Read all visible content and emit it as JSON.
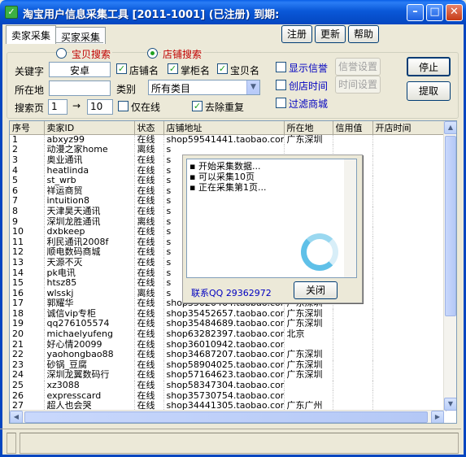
{
  "window": {
    "title": "淘宝用户信息采集工具 [2011-1001] (已注册) 到期:"
  },
  "tabs": [
    "卖家采集",
    "买家采集"
  ],
  "toolbar": {
    "register": "注册",
    "update": "更新",
    "help": "帮助"
  },
  "search": {
    "mode_item": "宝贝搜索",
    "mode_shop": "店铺搜索",
    "selected_mode": "店铺搜索",
    "keyword_label": "关键字",
    "keyword_value": "安卓",
    "location_label": "所在地",
    "location_value": "",
    "category_label": "类别",
    "category_value": "所有类目",
    "pages_label": "搜索页",
    "page_from": "1",
    "page_arrow": "→",
    "page_to": "10",
    "opt_shop_name": "店铺名",
    "opt_owner_name": "掌柜名",
    "opt_item_name": "宝贝名",
    "opt_online_only": "仅在线",
    "opt_dedupe": "去除重复",
    "opt_show_credit": "显示信誉",
    "opt_create_time": "创店时间",
    "opt_filter_mall": "过滤商城",
    "btn_credit_settings": "信誉设置",
    "btn_time_settings": "时间设置",
    "btn_stop": "停止",
    "btn_extract": "提取"
  },
  "table": {
    "columns": [
      "序号",
      "卖家ID",
      "状态",
      "店铺地址",
      "所在地",
      "信用值",
      "开店时间"
    ],
    "rows": [
      [
        "1",
        "abxyz99",
        "在线",
        "shop59541441.taobao.com",
        "广东深圳"
      ],
      [
        "2",
        "动漫之家home",
        "离线",
        "s",
        ""
      ],
      [
        "3",
        "奥业通讯",
        "在线",
        "s",
        ""
      ],
      [
        "4",
        "heatlinda",
        "在线",
        "s",
        ""
      ],
      [
        "5",
        "st_wrb",
        "在线",
        "s",
        ""
      ],
      [
        "6",
        "祥运商贸",
        "在线",
        "s",
        ""
      ],
      [
        "7",
        "intuition8",
        "在线",
        "s",
        ""
      ],
      [
        "8",
        "天津昊天通讯",
        "在线",
        "s",
        ""
      ],
      [
        "9",
        "深圳龙胜通讯",
        "离线",
        "s",
        ""
      ],
      [
        "10",
        "dxbkeep",
        "在线",
        "s",
        ""
      ],
      [
        "11",
        "利民通讯2008f",
        "在线",
        "s",
        ""
      ],
      [
        "12",
        "顺电数码商城",
        "在线",
        "s",
        ""
      ],
      [
        "13",
        "天源不灭",
        "在线",
        "s",
        ""
      ],
      [
        "14",
        "pk电讯",
        "在线",
        "s",
        ""
      ],
      [
        "15",
        "htsz85",
        "在线",
        "s",
        ""
      ],
      [
        "16",
        "wlsskj",
        "离线",
        "s",
        ""
      ],
      [
        "17",
        "郭耀华",
        "在线",
        "shop35026464.taobao.com",
        "广东深圳"
      ],
      [
        "18",
        "诚信vip专柜",
        "在线",
        "shop35452657.taobao.com",
        "广东深圳"
      ],
      [
        "19",
        "qq276105574",
        "在线",
        "shop35484689.taobao.com",
        "广东深圳"
      ],
      [
        "20",
        "michaelyufeng",
        "在线",
        "shop63282397.taobao.com",
        "北京"
      ],
      [
        "21",
        "好心情20099",
        "在线",
        "shop36010942.taobao.com",
        ""
      ],
      [
        "22",
        "yaohongbao88",
        "在线",
        "shop34687207.taobao.com",
        "广东深圳"
      ],
      [
        "23",
        "砂锅_豆腐",
        "在线",
        "shop58904025.taobao.com",
        "广东深圳"
      ],
      [
        "24",
        "深圳龙翼数码行",
        "在线",
        "shop57164623.taobao.com",
        "广东深圳"
      ],
      [
        "25",
        "xz3088",
        "在线",
        "shop58347304.taobao.com",
        ""
      ],
      [
        "26",
        "expresscard",
        "在线",
        "shop35730754.taobao.com",
        ""
      ],
      [
        "27",
        "超人也会哭",
        "在线",
        "shop34441305.taobao.com",
        "广东广州"
      ]
    ]
  },
  "popup": {
    "log_lines": [
      "开始采集数据...",
      "可以采集10页",
      "正在采集第1页..."
    ],
    "contact": "联系QQ  29362972",
    "close": "关闭"
  }
}
